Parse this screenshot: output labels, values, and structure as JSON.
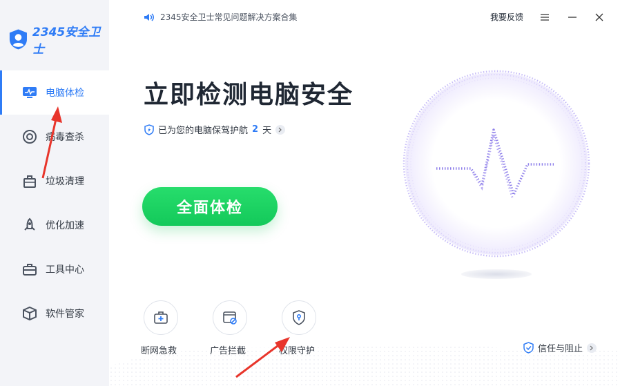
{
  "app": {
    "logo_text": "2345安全卫士",
    "notice": "2345安全卫士常见问题解决方案合集",
    "feedback": "我要反馈"
  },
  "sidebar": {
    "items": [
      {
        "label": "电脑体检",
        "icon": "monitor-icon",
        "active": true
      },
      {
        "label": "病毒查杀",
        "icon": "target-icon",
        "active": false
      },
      {
        "label": "垃圾清理",
        "icon": "trash-bin-icon",
        "active": false
      },
      {
        "label": "优化加速",
        "icon": "rocket-icon",
        "active": false
      },
      {
        "label": "工具中心",
        "icon": "toolbox-icon",
        "active": false
      },
      {
        "label": "软件管家",
        "icon": "box-icon",
        "active": false
      }
    ]
  },
  "main": {
    "headline": "立即检测电脑安全",
    "protect_prefix": "已为您的电脑保驾护航",
    "protect_days": "2",
    "protect_suffix": "天",
    "scan_button": "全面体检",
    "tools": [
      {
        "label": "断网急救",
        "icon": "first-aid-kit-icon"
      },
      {
        "label": "广告拦截",
        "icon": "ad-block-icon"
      },
      {
        "label": "权限守护",
        "icon": "shield-key-icon"
      }
    ],
    "trust_label": "信任与阻止"
  },
  "colors": {
    "accent": "#2f7cf6",
    "scan_green": "#1ed760",
    "annotation_red": "#e8352b",
    "orb_purple": "#9b8cf0"
  }
}
